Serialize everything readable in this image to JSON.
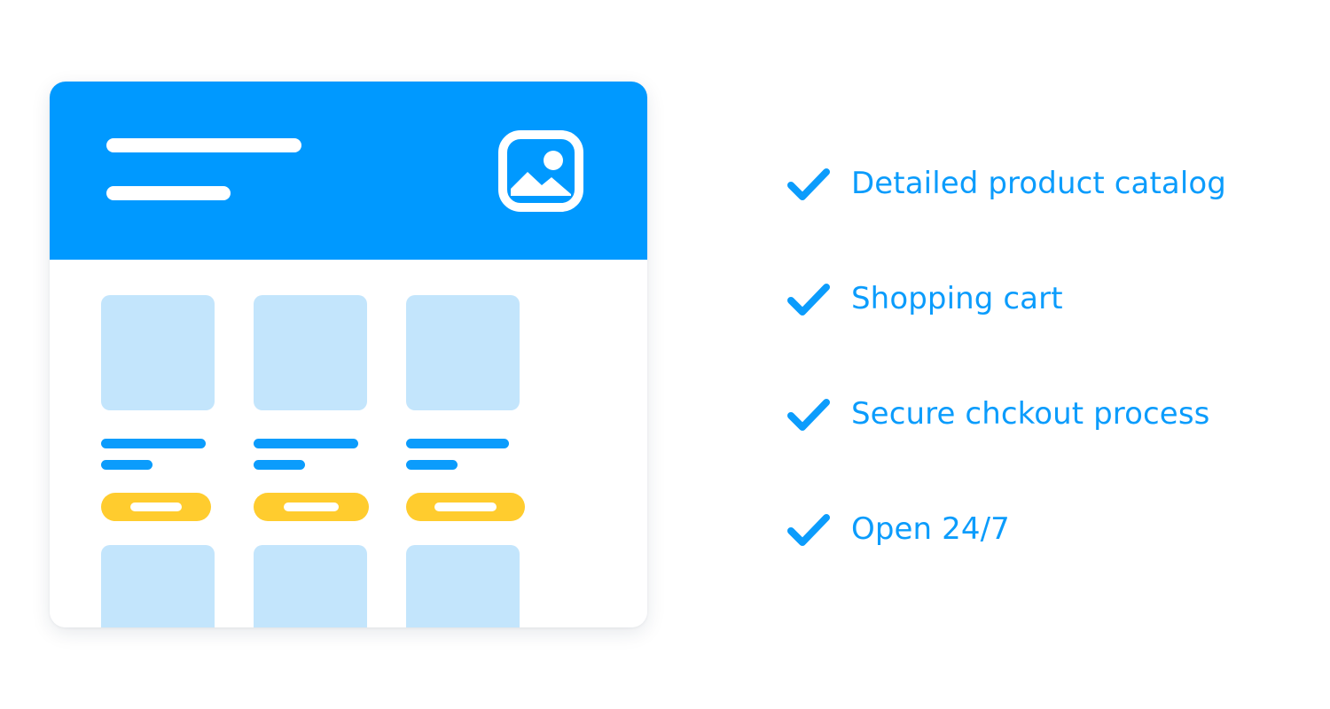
{
  "colors": {
    "brand_blue": "#0099ff",
    "text_blue": "#0b9cfc",
    "thumb_blue": "#c3e5fc",
    "accent_yellow": "#ffcc2e",
    "background": "#ffffff",
    "placeholder_white": "#ffffff"
  },
  "shop_card": {
    "header": {
      "title_placeholder_name": "title-placeholder-bar",
      "subtitle_placeholder_name": "subtitle-placeholder-bar",
      "icon": "image-icon"
    },
    "products": [
      {
        "id": "product-1",
        "thumbnail": "product-thumbnail",
        "title_placeholder": "product-title-bar",
        "subtitle_placeholder": "product-subtitle-bar",
        "button": "buy-button",
        "button_label_placeholder": "buy-button-label-bar"
      },
      {
        "id": "product-2",
        "thumbnail": "product-thumbnail",
        "title_placeholder": "product-title-bar",
        "subtitle_placeholder": "product-subtitle-bar",
        "button": "buy-button",
        "button_label_placeholder": "buy-button-label-bar"
      },
      {
        "id": "product-3",
        "thumbnail": "product-thumbnail",
        "title_placeholder": "product-title-bar",
        "subtitle_placeholder": "product-subtitle-bar",
        "button": "buy-button",
        "button_label_placeholder": "buy-button-label-bar"
      },
      {
        "id": "product-4",
        "thumbnail": "product-thumbnail"
      },
      {
        "id": "product-5",
        "thumbnail": "product-thumbnail"
      },
      {
        "id": "product-6",
        "thumbnail": "product-thumbnail"
      }
    ]
  },
  "features": {
    "icon": "check-icon",
    "items": [
      {
        "label": "Detailed product catalog"
      },
      {
        "label": "Shopping cart"
      },
      {
        "label": "Secure chckout process"
      },
      {
        "label": "Open 24/7"
      }
    ]
  }
}
